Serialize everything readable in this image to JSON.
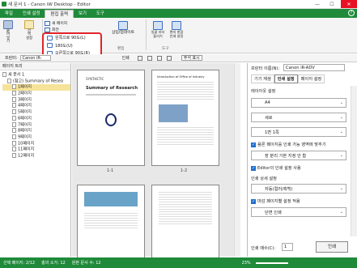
{
  "window": {
    "title": "새 문서 1 - Canon iW Desktop - Editor",
    "min": "—",
    "max": "☐",
    "close": "✕"
  },
  "menu": {
    "items": [
      "파일",
      "인쇄 설정",
      "편집 출력",
      "보기",
      "도구"
    ],
    "active_index": 2
  },
  "ribbon": {
    "paste": "붙\n여\n넣\n기",
    "select": "선\n택\n설정",
    "new_page": "새 페이지",
    "rotate_label": "회전",
    "hl_items": [
      "왼쪽으로 90도(L)",
      "180도(U)",
      "오른쪽으로 90도(R)"
    ],
    "insert_label": "삽입/업데이트",
    "group_edit": "편집",
    "group_tools": "도구",
    "batch": "일괄 리터\n플리기",
    "batch2": "편지 봉합\n인쇄 설정",
    "group_page": "페이지",
    "group_other": "설치"
  },
  "toolbar": {
    "printer_label": "프린터:",
    "printer_value": "Canon iR-",
    "zoom": "인쇄",
    "annotation": "주석 표시"
  },
  "left_panel": {
    "title": "페이지 트리",
    "root": "새 문서 1",
    "child": "(참고) Summary of Resea",
    "pages": [
      "1페이지",
      "2페이지",
      "3페이지",
      "4페이지",
      "5페이지",
      "6페이지",
      "7페이지",
      "8페이지",
      "9페이지",
      "10페이지",
      "11페이지",
      "12페이지"
    ],
    "selected_index": 0
  },
  "center": {
    "page_labels": [
      "1-1",
      "1-2"
    ],
    "page1_title": "Summary of Research",
    "page2_title": "Introduction of Office of Industry"
  },
  "right_panel": {
    "printer_label": "프린터 이름(N):",
    "printer_value": "Canon iR-ADV",
    "tabs": [
      "기기 재생",
      "인쇄 설정",
      "페이지 설정"
    ],
    "active_tab": 1,
    "section_layout": "레이아웃 설정",
    "paper": "A4",
    "orientation": "세로",
    "pages_per_sheet": "1면 1쪽",
    "chk_fit": "용론 페이지를 인쇄 가능 영역에 맞추기",
    "binding": "장 분리 기본 지정 안 함",
    "chk_editor": "Editor의 인쇄 설정 사용",
    "section_color": "인쇄 상세 설정",
    "color_mode": "자동(컬러/흑백)",
    "chk_finish": "마감 페이지별 설정 적용",
    "duplex": "단면 인쇄",
    "copies_label": "인쇄 매수(C):",
    "copies_value": "1",
    "print_button": "인쇄"
  },
  "status": {
    "selected": "선택 페이지: 2/12",
    "total": "총의 소가: 12",
    "doc": "원본 문서 수: 12",
    "zoom": "23%"
  },
  "colors": {
    "accent": "#1f8a3a",
    "highlight": "#e0242a"
  }
}
